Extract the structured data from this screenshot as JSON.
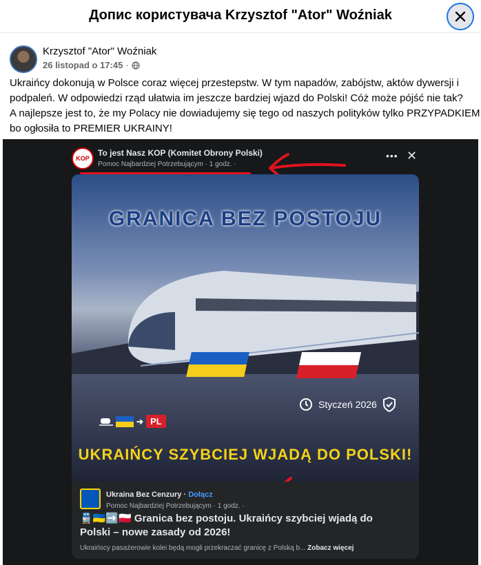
{
  "dialog": {
    "title": "Допис користувача Krzysztof \"Ator\" Woźniak"
  },
  "post": {
    "author": "Krzysztof \"Ator\" Woźniak",
    "date": "26 listopad o 17:45",
    "lines": [
      "Ukraińcy dokonują w Polsce coraz więcej przestepstw. W tym napadów, zabójstw, aktów dywersji i",
      "podpaleń. W odpowiedzi rząd ułatwia im jeszcze bardziej wjazd do Polski! Cóż może pójść nie tak?",
      "A najlepsze jest to, że my  Polacy nie dowiadujemy się tego od naszych polityków tylko PRZYPADKIEM,",
      "bo ogłosiła to PREMIER UKRAINY!"
    ]
  },
  "shared_post": {
    "page_name": "To jest Nasz KOP (Komitet Obrony Polski)",
    "meta": "Pomoc Najbardziej Potrzebującym · 1 godz. ·",
    "poster": {
      "title": "GRANICA BEZ POSTOJU",
      "date_label": "Styczeń 2026",
      "route_label": "PL",
      "bottom_text": "UKRAIŃCY SZYBCIEJ WJADĄ DO POLSKI!"
    }
  },
  "link_card": {
    "source": "Ukraina Bez Cenzury",
    "join": "Dołącz",
    "meta": "Pomoc Najbardziej Potrzebującym · 1 godz. ·",
    "headline": "Granica bez postoju. Ukraińcy szybciej wjadą do Polski – nowe zasady od 2026!",
    "snippet": "Ukraińscy pasażerowie kolei będą mogli przekraczać granicę z Polską b...",
    "see_more": "Zobacz więcej"
  },
  "colors": {
    "accent": "#1b74e4",
    "annotation_red": "#e0131d",
    "poster_yellow": "#f4d31a"
  }
}
